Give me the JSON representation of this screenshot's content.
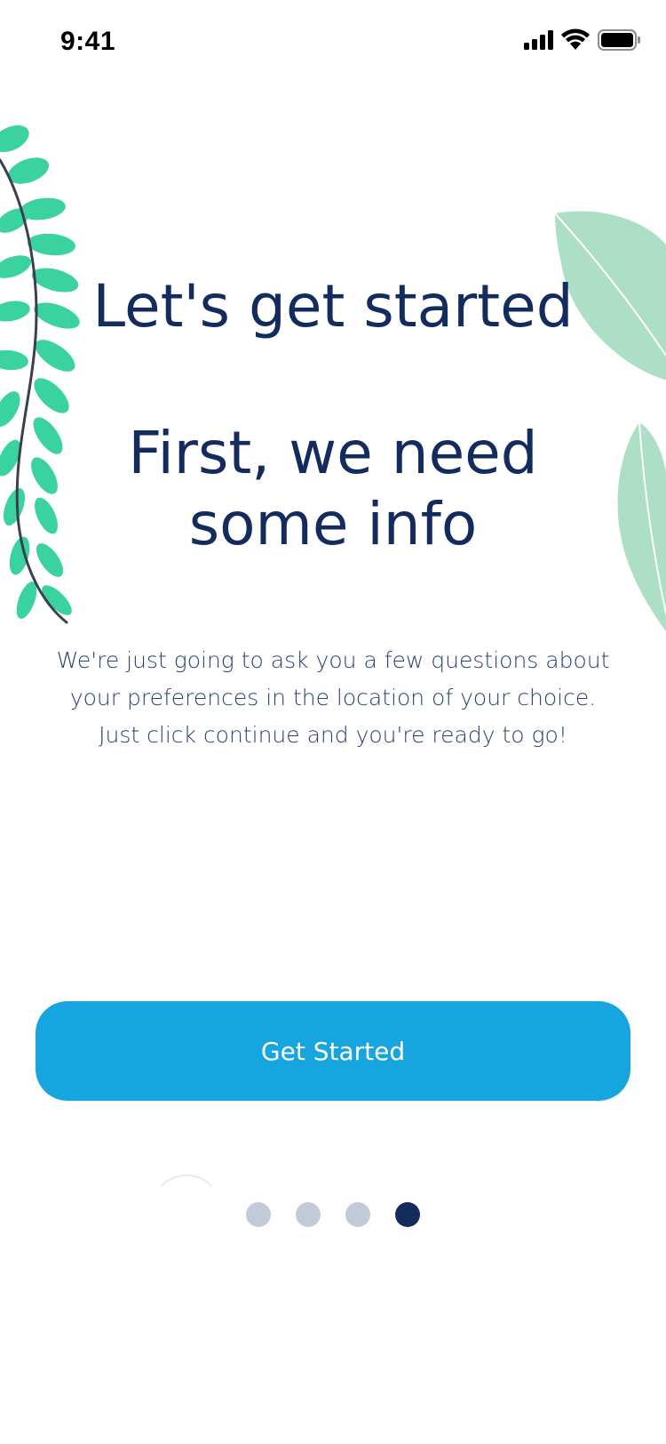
{
  "status_bar": {
    "time": "9:41",
    "icons": [
      "cellular-signal-icon",
      "wifi-icon",
      "battery-icon"
    ]
  },
  "onboarding": {
    "title": "Let's get started",
    "subtitle_line1": "First, we need",
    "subtitle_line2": "some info",
    "description_line1": "We're just going to ask you a few questions about",
    "description_line2": "your preferences in the location of your choice.",
    "description_line3": "Just click continue and you're ready to go!",
    "button_label": "Get Started"
  },
  "pager": {
    "total_pages": 4,
    "active_page": 4
  },
  "colors": {
    "primary_text": "#142b5e",
    "accent_button": "#17a5e0",
    "leaf_green": "#3ad29f",
    "leaf_pale": "#addfc6",
    "dot_inactive": "#c3cad7",
    "dot_active": "#142b5e"
  }
}
